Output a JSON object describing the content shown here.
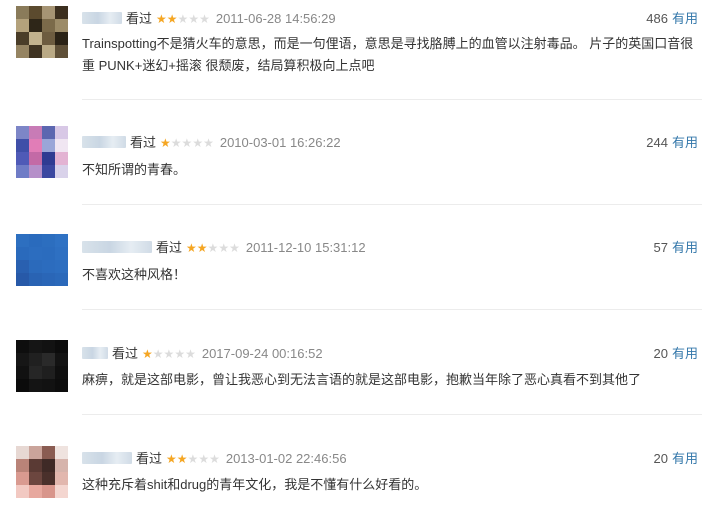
{
  "reviews": [
    {
      "seen_label": "看过",
      "rating": 2,
      "time": "2011-06-28 14:56:29",
      "votes": "486",
      "useful_label": "有用",
      "content": "Trainspotting不是猜火车的意思，而是一句俚语，意思是寻找胳膊上的血管以注射毒品。 片子的英国口音很重 PUNK+迷幻+摇滚 很颓废，结局算积极向上点吧",
      "avatar_colors": [
        "#8a7b5a",
        "#5b4a2e",
        "#a69474",
        "#3c2f1f",
        "#b4a27c",
        "#2e2618",
        "#7b6a4a",
        "#9c8b68",
        "#4a3d28",
        "#c2b28e",
        "#6d5c40",
        "#2a2216",
        "#958462",
        "#3f3322",
        "#b9a985",
        "#5f5038"
      ]
    },
    {
      "seen_label": "看过",
      "rating": 1,
      "time": "2010-03-01 16:26:22",
      "votes": "244",
      "useful_label": "有用",
      "content": "不知所谓的青春。",
      "avatar_colors": [
        "#7d86c7",
        "#c87bb6",
        "#5c67b0",
        "#d8c8e6",
        "#3f4fa8",
        "#e17db7",
        "#9aa6d8",
        "#f0e6f2",
        "#4f5ab7",
        "#c36aa6",
        "#2f3b92",
        "#e3b3d3",
        "#6f7cc6",
        "#b58fc9",
        "#3b47a0",
        "#d9d2ea"
      ]
    },
    {
      "seen_label": "看过",
      "rating": 2,
      "time": "2011-12-10 15:31:12",
      "votes": "57",
      "useful_label": "有用",
      "content": "不喜欢这种风格！",
      "avatar_colors": [
        "#2d6fc0",
        "#2a6bbd",
        "#2c6ebf",
        "#2f72c4",
        "#2a6abc",
        "#2c6dbf",
        "#2b6cbe",
        "#2e70c2",
        "#2960b0",
        "#2b6abb",
        "#2c6cbe",
        "#2d6ec0",
        "#2759a8",
        "#2963b3",
        "#2a66b7",
        "#2b69ba"
      ]
    },
    {
      "seen_label": "看过",
      "rating": 1,
      "time": "2017-09-24 00:16:52",
      "votes": "20",
      "useful_label": "有用",
      "content": "麻痹，就是这部电影，曾让我恶心到无法言语的就是这部电影，抱歉当年除了恶心真看不到其他了",
      "avatar_colors": [
        "#0e0e0e",
        "#151515",
        "#121212",
        "#0c0c0c",
        "#161616",
        "#202020",
        "#2a2a2a",
        "#131313",
        "#111111",
        "#262626",
        "#1f1f1f",
        "#0f0f0f",
        "#0b0b0b",
        "#141414",
        "#121212",
        "#0d0d0d"
      ]
    },
    {
      "seen_label": "看过",
      "rating": 2,
      "time": "2013-01-02 22:46:56",
      "votes": "20",
      "useful_label": "有用",
      "content": "这种充斥着shit和drug的青年文化，我是不懂有什么好看的。",
      "avatar_colors": [
        "#e7d8d3",
        "#caa49b",
        "#8a5c52",
        "#efe3df",
        "#b98378",
        "#5a3a34",
        "#3f2a26",
        "#d6b4ac",
        "#d99a90",
        "#6c463f",
        "#4a302b",
        "#e2b7ae",
        "#f2c9c2",
        "#e7a89e",
        "#d8958b",
        "#f4d6d0"
      ]
    }
  ]
}
